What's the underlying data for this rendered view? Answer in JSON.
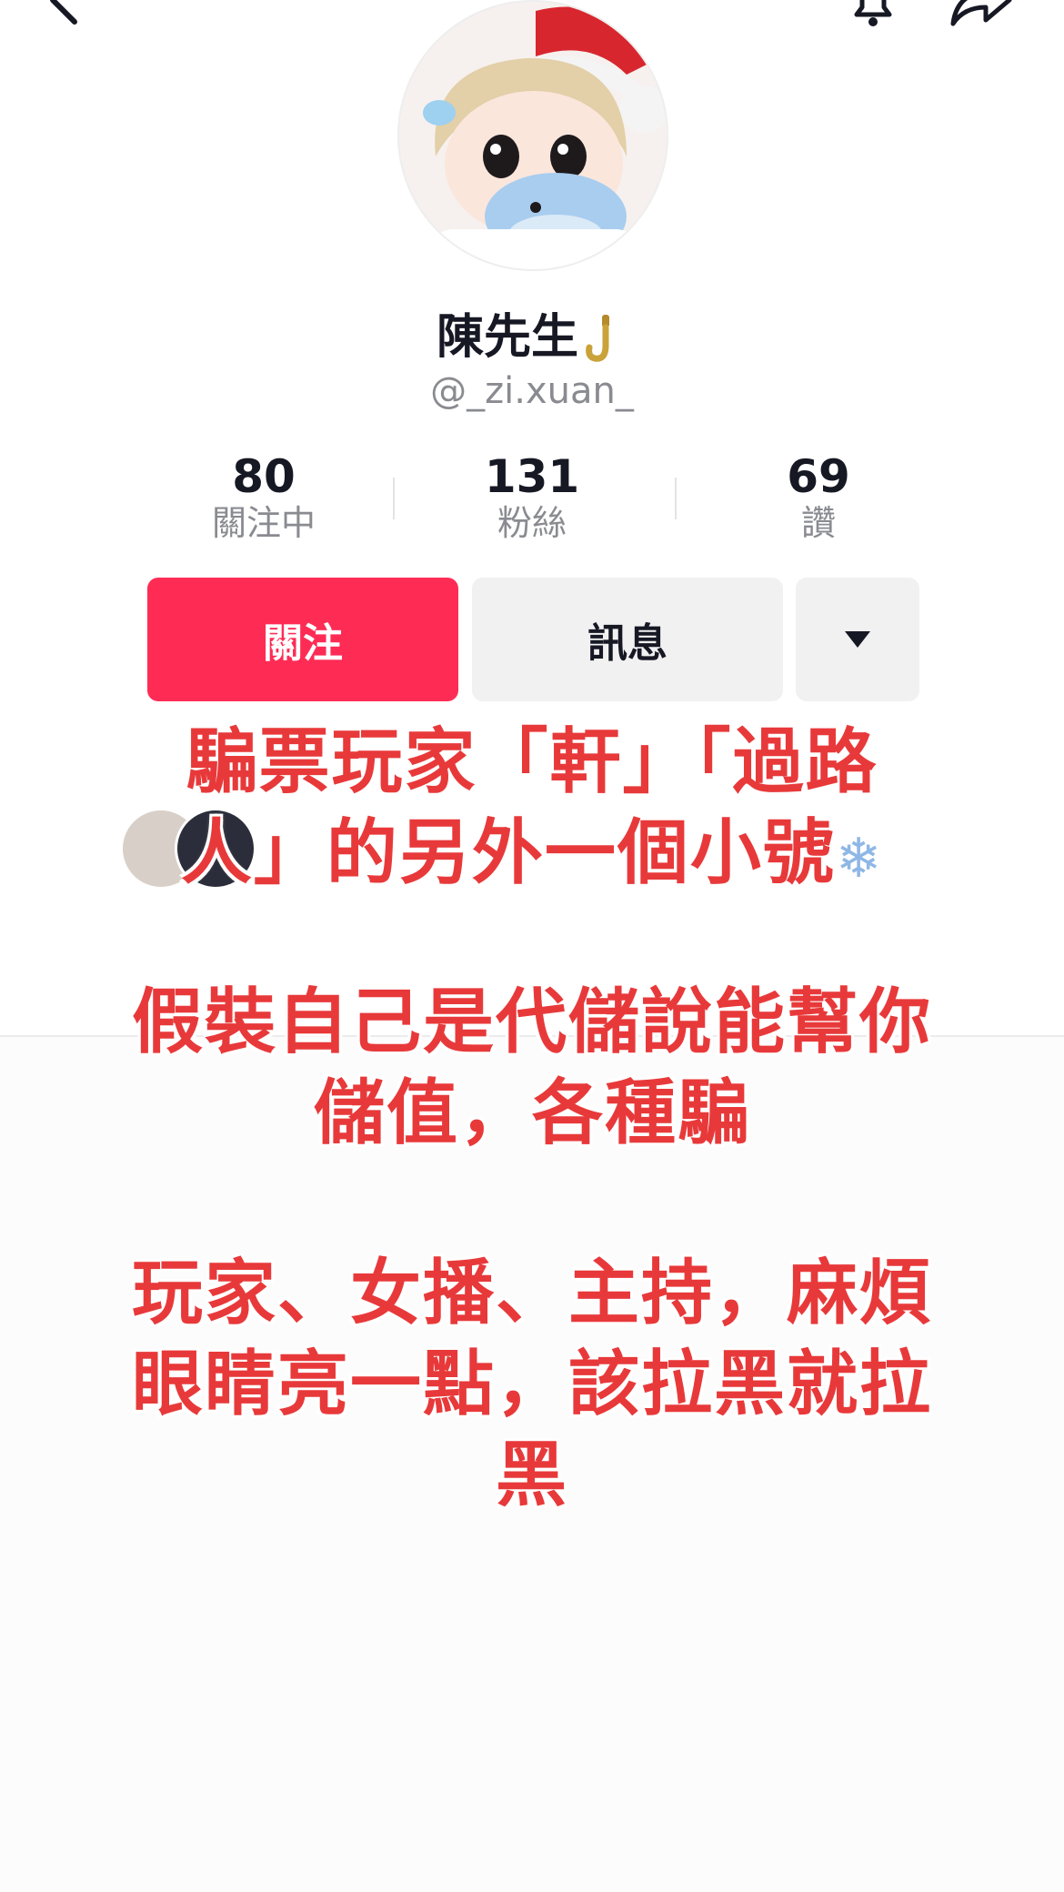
{
  "profile": {
    "display_name": "陳先生",
    "name_emoji": "hook-icon",
    "handle": "@_zi.xuan_"
  },
  "stats": [
    {
      "value": "80",
      "label": "關注中"
    },
    {
      "value": "131",
      "label": "粉絲"
    },
    {
      "value": "69",
      "label": "讚"
    }
  ],
  "actions": {
    "follow_label": "關注",
    "message_label": "訊息",
    "more_icon": "triangle-down-icon"
  },
  "overlay_text": {
    "line1": "騙票玩家「軒」「過路",
    "line2": "人」的另外一個小號",
    "line3": "假裝自己是代儲說能幫你",
    "line4": "儲值，各種騙",
    "line5": "玩家、女播、主持，麻煩",
    "line6": "眼睛亮一點，該拉黑就拉",
    "line7": "黑"
  },
  "colors": {
    "follow_button": "#fe2c55",
    "overlay_text": "#e8393a",
    "muted_text": "#8a8b91"
  }
}
